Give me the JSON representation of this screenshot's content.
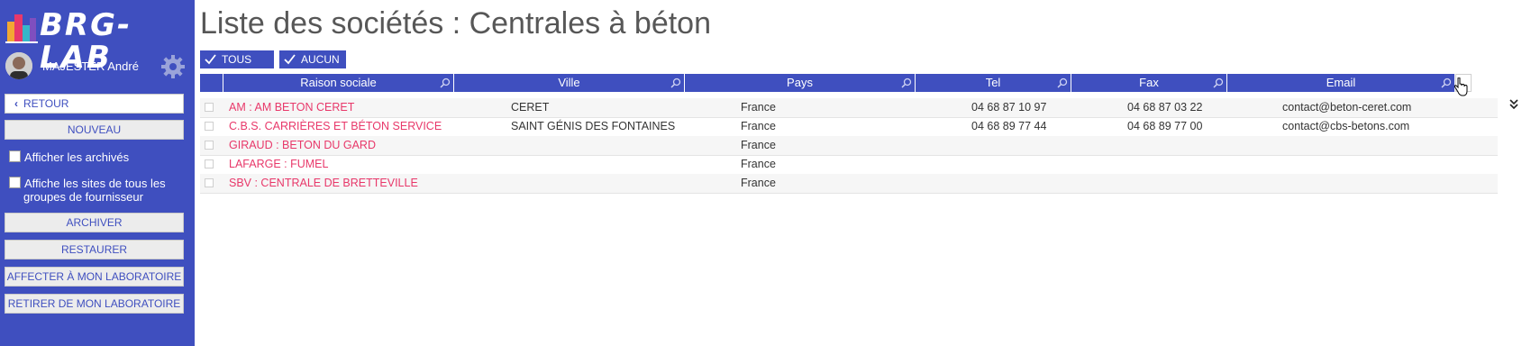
{
  "app": {
    "logo_text": "BRG-LAB"
  },
  "user": {
    "name": "MAJESTER André"
  },
  "sidebar": {
    "back_label": "RETOUR",
    "new_label": "NOUVEAU",
    "show_archived_label": "Afficher les archivés",
    "show_all_sites_label_1": "Affiche les sites de tous les",
    "show_all_sites_label_2": "groupes de fournisseur",
    "archive_label": "ARCHIVER",
    "restore_label": "RESTAURER",
    "assign_label": "AFFECTER À MON LABORATOIRE",
    "remove_label": "RETIRER DE MON LABORATOIRE"
  },
  "page": {
    "title": "Liste des sociétés : Centrales à béton"
  },
  "toolbar": {
    "all_label": "TOUS",
    "none_label": "AUCUN"
  },
  "table": {
    "columns": [
      "Raison sociale",
      "Ville",
      "Pays",
      "Tel",
      "Fax",
      "Email"
    ],
    "rows": [
      {
        "name": "AM : AM BETON CERET",
        "city": "CERET",
        "country": "France",
        "tel": "04 68 87 10 97",
        "fax": "04 68 87 03 22",
        "email": "contact@beton-ceret.com"
      },
      {
        "name": "C.B.S. CARRIÈRES ET BÉTON SERVICE",
        "city": "SAINT GÉNIS DES FONTAINES",
        "country": "France",
        "tel": "04 68 89 77 44",
        "fax": "04 68 89 77 00",
        "email": "contact@cbs-betons.com"
      },
      {
        "name": "GIRAUD : BETON DU GARD",
        "city": "",
        "country": "France",
        "tel": "",
        "fax": "",
        "email": ""
      },
      {
        "name": "LAFARGE : FUMEL",
        "city": "",
        "country": "France",
        "tel": "",
        "fax": "",
        "email": ""
      },
      {
        "name": "SBV : CENTRALE DE BRETTEVILLE",
        "city": "",
        "country": "France",
        "tel": "",
        "fax": "",
        "email": ""
      }
    ]
  },
  "colors": {
    "brand": "#3f4fbf",
    "link": "#e8386a"
  },
  "icons": [
    "logo-icon",
    "avatar",
    "gear-icon",
    "chevron-left-icon",
    "check-icon",
    "search-icon",
    "double-chevron-down-icon",
    "hand-cursor-icon"
  ]
}
